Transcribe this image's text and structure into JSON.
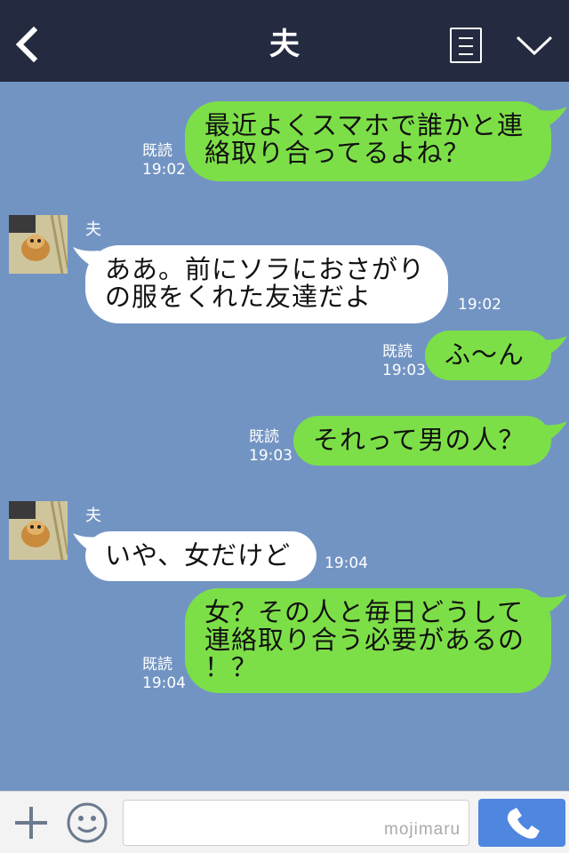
{
  "header": {
    "title": "夫"
  },
  "messages": [
    {
      "side": "me",
      "text": "最近よくスマホで誰かと連\n絡取り合ってるよね？",
      "read": "既読",
      "time": "19:02"
    },
    {
      "side": "them",
      "sender": "夫",
      "text": "ああ。前にソラにおさがり\nの服をくれた友達だよ",
      "time": "19:02"
    },
    {
      "side": "me",
      "text": "ふ〜ん",
      "read": "既読",
      "time": "19:03"
    },
    {
      "side": "me",
      "text": "それって男の人？",
      "read": "既読",
      "time": "19:03"
    },
    {
      "side": "them",
      "sender": "夫",
      "text": "いや、女だけど",
      "time": "19:04"
    },
    {
      "side": "me",
      "text": "女？その人と毎日どうして\n連絡取り合う必要があるの\n！？",
      "read": "既読",
      "time": "19:04"
    }
  ],
  "footer": {
    "input_placeholder": "",
    "watermark": "mojimaru"
  },
  "colors": {
    "background": "#7294c3",
    "header": "#242b40",
    "my_bubble": "#7ddf48",
    "their_bubble": "#ffffff",
    "call_button": "#4f86e0"
  },
  "icons": {
    "back": "chevron-left-icon",
    "menu": "list-icon",
    "collapse": "chevron-down-icon",
    "add": "plus-icon",
    "sticker": "smiley-icon",
    "call": "phone-icon"
  }
}
